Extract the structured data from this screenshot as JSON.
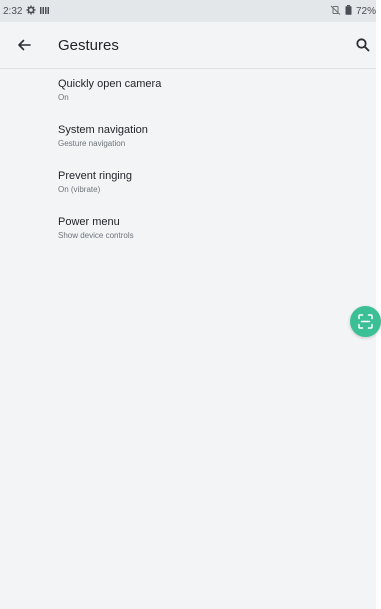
{
  "status_bar": {
    "time": "2:32",
    "battery": "72%",
    "icons": [
      "settings-gear-icon",
      "signal-bars-icon",
      "no-vibrate-icon",
      "battery-icon"
    ]
  },
  "toolbar": {
    "title": "Gestures",
    "back_icon": "arrow-left-icon",
    "search_icon": "search-icon"
  },
  "gestures": {
    "items": [
      {
        "title": "Quickly open camera",
        "subtitle": "On"
      },
      {
        "title": "System navigation",
        "subtitle": "Gesture navigation"
      },
      {
        "title": "Prevent ringing",
        "subtitle": "On (vibrate)"
      },
      {
        "title": "Power menu",
        "subtitle": "Show device controls"
      }
    ]
  },
  "floating_button": {
    "icon": "scan-frame-icon",
    "color": "#3bbf94"
  }
}
